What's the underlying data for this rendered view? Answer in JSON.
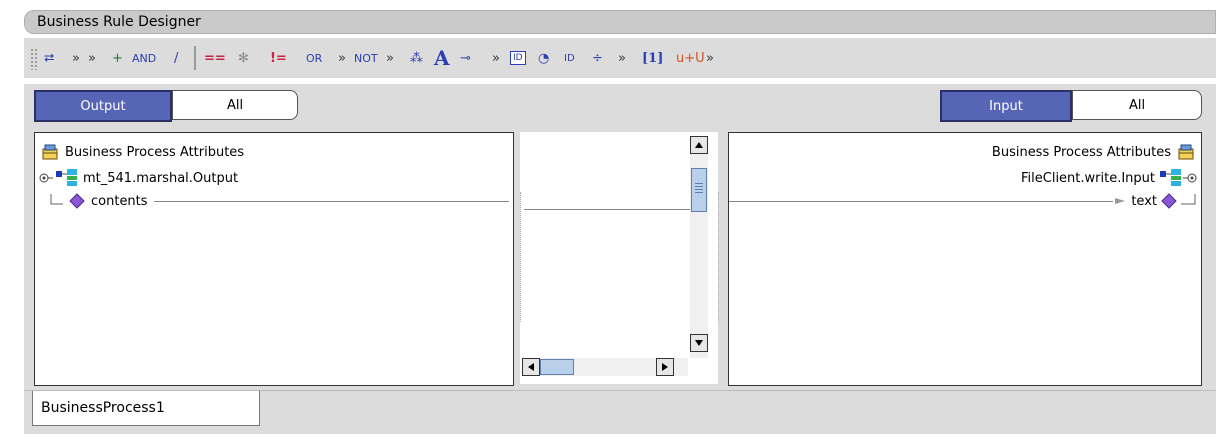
{
  "window": {
    "title": "Business Rule Designer"
  },
  "toolbar": {
    "items": [
      {
        "name": "method-palette-icon",
        "glyph": "⮂"
      },
      {
        "name": "expand-left-icon",
        "glyph": "»"
      },
      {
        "name": "expand-left-icon-2",
        "glyph": "»"
      },
      {
        "name": "add-icon",
        "glyph": "+"
      },
      {
        "name": "and-operator",
        "glyph": "AND"
      },
      {
        "name": "divide-icon",
        "glyph": "/"
      },
      {
        "name": "equal-icon",
        "glyph": "=="
      },
      {
        "name": "asterisk-icon",
        "glyph": "✻"
      },
      {
        "name": "not-equal-icon",
        "glyph": "!="
      },
      {
        "name": "or-operator",
        "glyph": "OR"
      },
      {
        "name": "expand-icon-1",
        "glyph": "»"
      },
      {
        "name": "not-operator",
        "glyph": "NOT"
      },
      {
        "name": "expand-icon-2",
        "glyph": "»"
      },
      {
        "name": "dot-operator-icon",
        "glyph": "⁂"
      },
      {
        "name": "text-icon",
        "glyph": "A"
      },
      {
        "name": "connect-icon",
        "glyph": "⊸"
      },
      {
        "name": "expand-icon-3",
        "glyph": "»"
      },
      {
        "name": "id-card-icon",
        "glyph": "ID"
      },
      {
        "name": "timer-icon",
        "glyph": "◔"
      },
      {
        "name": "id-arrow-icon",
        "glyph": "ID"
      },
      {
        "name": "split-icon",
        "glyph": "÷"
      },
      {
        "name": "expand-icon-4",
        "glyph": "»"
      },
      {
        "name": "array-index-icon",
        "glyph": "[1]"
      },
      {
        "name": "unicode-icon",
        "glyph": "u+U"
      },
      {
        "name": "expand-icon-5",
        "glyph": "»"
      }
    ]
  },
  "left": {
    "active_label": "Output",
    "inactive_label": "All",
    "tree": {
      "root": "Business Process Attributes",
      "node": "mt_541.marshal.Output",
      "leaf": "contents"
    }
  },
  "right": {
    "active_label": "Input",
    "inactive_label": "All",
    "tree": {
      "root": "Business Process Attributes",
      "node": "FileClient.write.Input",
      "leaf": "text"
    }
  },
  "bottom_tab": {
    "label": "BusinessProcess1"
  },
  "colors": {
    "active_segment": "#5665b6",
    "toolbar_bg": "#dcdcdc",
    "diamond": "#8b55d6",
    "equal_red": "#cc2244",
    "operator_blue": "#2a3fb0"
  }
}
